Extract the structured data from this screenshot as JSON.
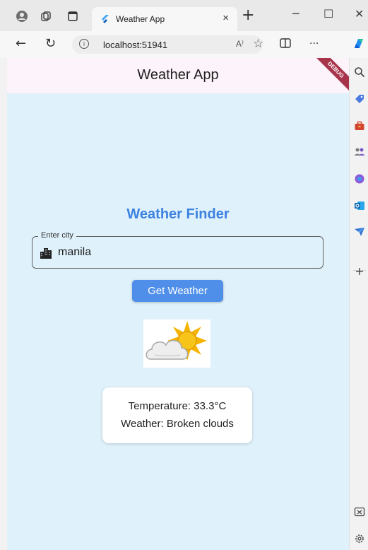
{
  "browser": {
    "tab": {
      "title": "Weather App",
      "close_label": "×"
    },
    "new_tab_label": "+",
    "window_controls": {
      "minimize": "─",
      "maximize": "☐",
      "close": "✕"
    },
    "address": {
      "url": "localhost:51941",
      "read_aloud_label": "A⁾"
    },
    "toolbar": {
      "more_label": "···"
    },
    "icons": [
      "profile-icon",
      "workspaces-icon",
      "tab-actions-icon",
      "flutter-favicon",
      "back-icon",
      "refresh-icon",
      "info-icon",
      "read-aloud-icon",
      "favorite-star-icon",
      "split-screen-icon",
      "more-icon",
      "copilot-icon"
    ],
    "sidebar_icons": [
      "search-icon",
      "shopping-tag-icon",
      "tools-icon",
      "people-icon",
      "copilot-app-icon",
      "outlook-icon",
      "send-icon",
      "add-icon",
      "screenshot-icon",
      "settings-icon"
    ]
  },
  "app": {
    "title": "Weather App",
    "debug_banner": "DEBUG",
    "heading": "Weather Finder",
    "city_field": {
      "label": "Enter city",
      "value": "manila",
      "icon": "location-city-icon"
    },
    "button_label": "Get Weather",
    "weather_icon": "partly-cloudy-icon",
    "result": {
      "temperature": "Temperature: 33.3°C",
      "condition": "Weather: Broken clouds"
    }
  },
  "colors": {
    "app_background": "#dff1fb",
    "appbar_background": "#fdf3fb",
    "heading": "#3d82e0",
    "button": "#4f8fe9",
    "debug_banner": "#a7344a"
  }
}
